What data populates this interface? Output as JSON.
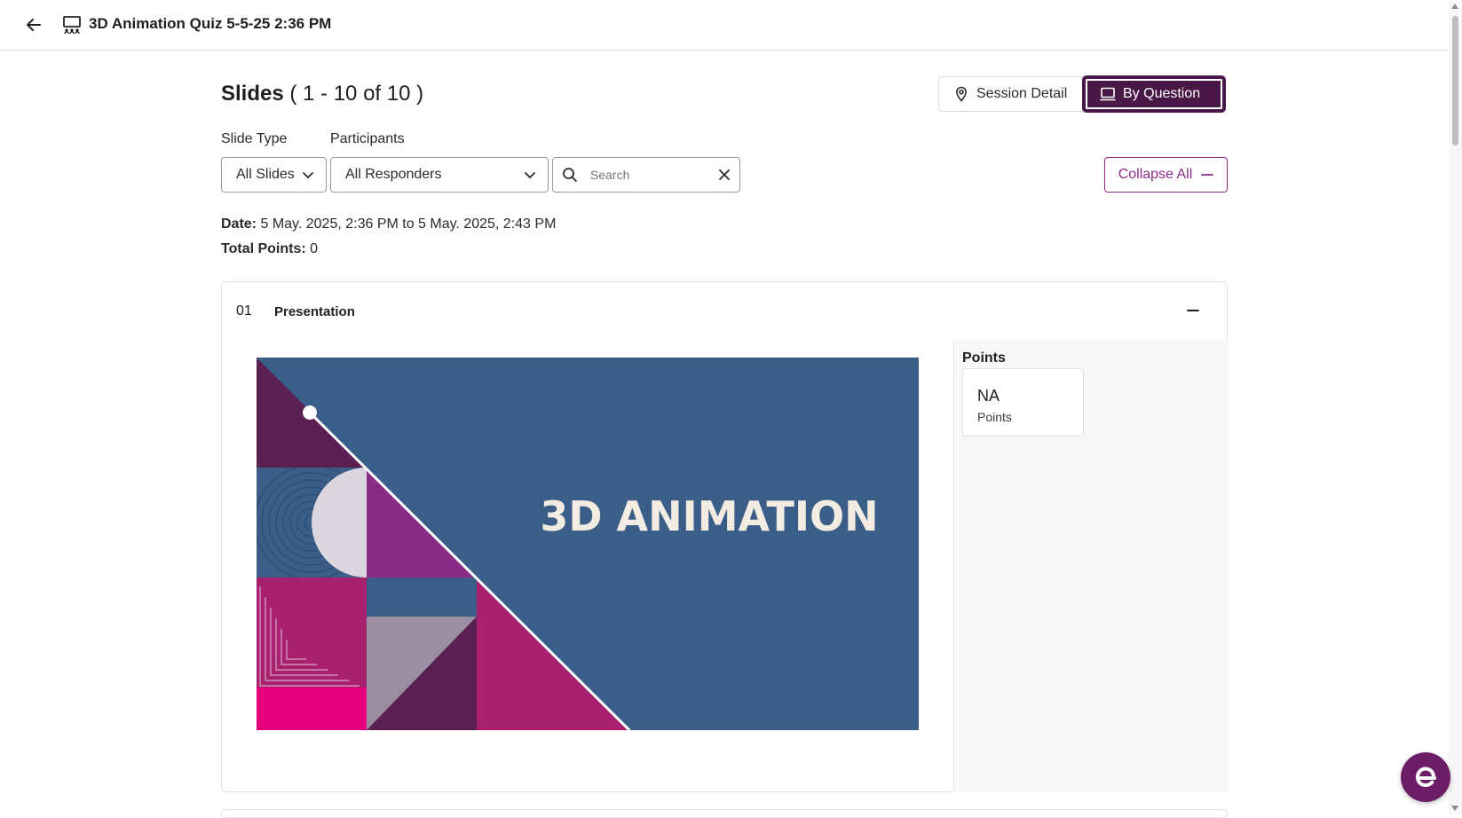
{
  "header": {
    "title": "3D Animation Quiz 5-5-25 2:36 PM",
    "back_icon": "arrow-left-icon",
    "title_icon": "presentation-board-icon"
  },
  "slides": {
    "title": "Slides",
    "range": "( 1 - 10 of 10 )"
  },
  "view_toggle": {
    "session_detail_label": "Session Detail",
    "by_question_label": "By Question",
    "active": "By Question"
  },
  "filters": {
    "slide_type_label": "Slide Type",
    "slide_type_value": "All Slides",
    "participants_label": "Participants",
    "participants_value": "All Responders",
    "search_placeholder": "Search",
    "search_value": ""
  },
  "collapse_all_label": "Collapse All",
  "meta": {
    "date_label": "Date:",
    "date_value": "5 May. 2025, 2:36 PM to 5 May. 2025, 2:43 PM",
    "total_points_label": "Total Points:",
    "total_points_value": "0"
  },
  "cards": [
    {
      "number": "01",
      "type": "Presentation",
      "slide_text": "3D ANIMATION",
      "points_heading": "Points",
      "points_value": "NA",
      "points_unit": "Points"
    }
  ],
  "colors": {
    "brand": "#4a1847",
    "accent": "#8a2c86",
    "slide_bg": "#3a5e88"
  }
}
